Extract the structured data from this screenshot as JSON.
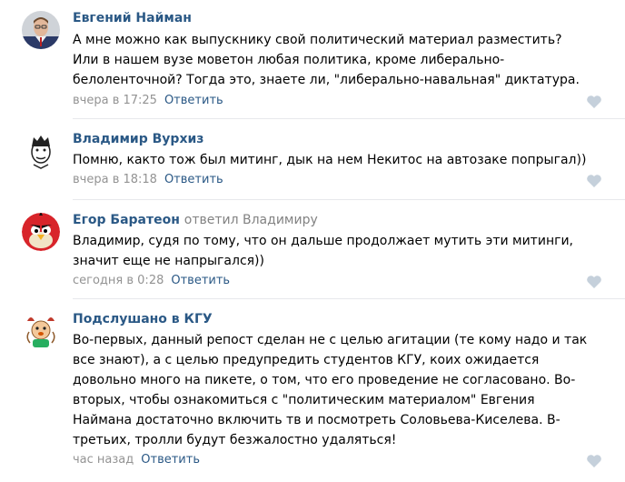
{
  "comments": [
    {
      "author": "Евгений Найман",
      "reply_to": "",
      "lines": [
        "А мне можно как выпускнику свой политический материал разместить?",
        "Или в нашем вузе моветон любая политика, кроме либерально-",
        "белоленточной? Тогда это, знаете ли, \"либерально-навальная\" диктатура."
      ],
      "time": "вчера в 17:25",
      "reply_label": "Ответить",
      "avatar": "user-photo"
    },
    {
      "author": "Владимир Вурхиз",
      "reply_to": "",
      "lines": [
        "Помню, както тож был митинг, дык на нем Некитос на автозаке попрыгал))"
      ],
      "time": "вчера в 18:18",
      "reply_label": "Ответить",
      "avatar": "cartoon-face"
    },
    {
      "author": "Егор Баратеон",
      "reply_to": "ответил Владимиру",
      "lines": [
        "Владимир, судя по тому, что он дальше продолжает мутить эти митинги,",
        "значит еще не напрыгался))"
      ],
      "time": "сегодня в 0:28",
      "reply_label": "Ответить",
      "avatar": "angry-bird"
    },
    {
      "author": "Подслушано в КГУ",
      "reply_to": "",
      "lines": [
        "Во-первых, данный репост сделан не с целью агитации (те кому надо и так",
        "все знают), а с целью предупредить студентов КГУ, коих ожидается",
        "довольно много на пикете, о том, что его проведение не согласовано. Во-",
        "вторых, чтобы ознакомиться с \"политическим материалом\" Евгения",
        "Наймана достаточно включить тв и посмотреть Соловьева-Киселева. В-",
        "третьих, тролли будут безжалостно удаляться!"
      ],
      "time": "час назад",
      "reply_label": "Ответить",
      "avatar": "group-logo"
    }
  ],
  "colors": {
    "link": "#2a5885",
    "meta": "#939393",
    "separator": "#e7e8ec",
    "like_icon": "#c5d0db"
  }
}
